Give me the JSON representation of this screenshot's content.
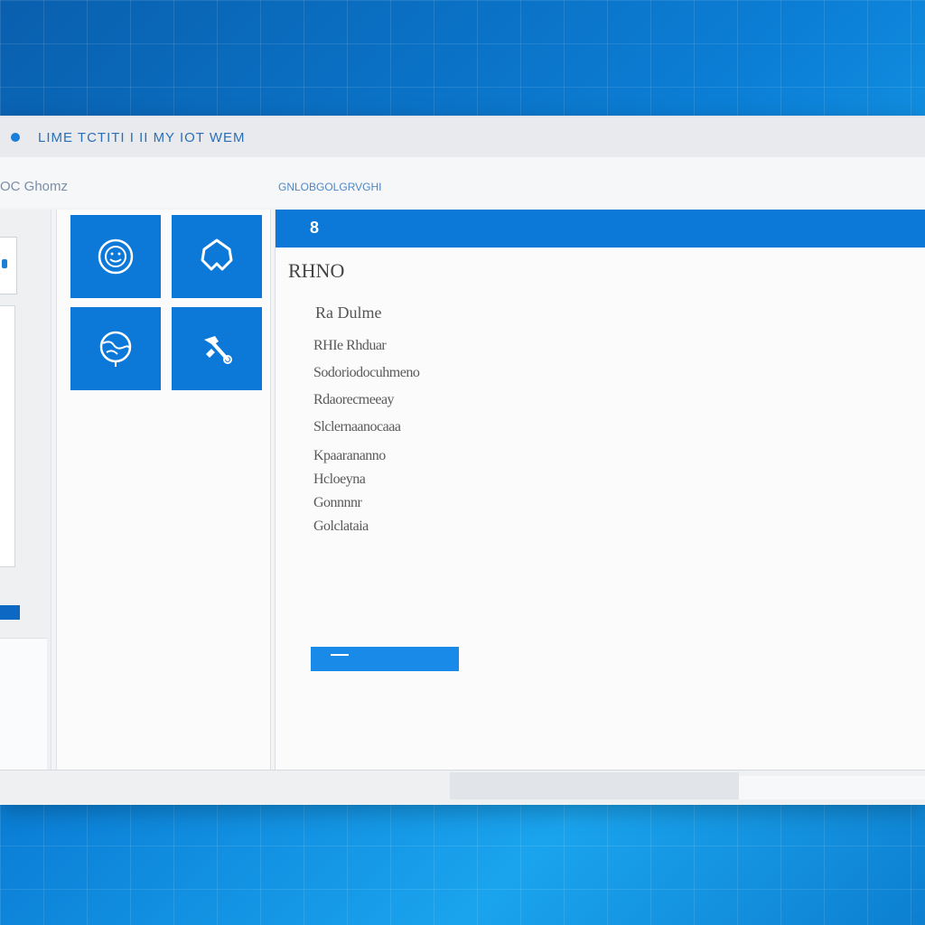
{
  "window": {
    "title": "LIME TCTITI I II MY IOT WEM"
  },
  "toolbar": {
    "left_label": "OC Ghomz",
    "right_label": "GNLOBGOLGRVGHI"
  },
  "tiles": [
    {
      "icon": "smiley-icon"
    },
    {
      "icon": "shield-icon"
    },
    {
      "icon": "globe-icon"
    },
    {
      "icon": "tools-icon"
    }
  ],
  "main": {
    "header_label": "8",
    "title": "RHNO",
    "section_title": "Ra Dulme",
    "items": [
      "RHIe Rhduar",
      "Sodoriodocuhmeno",
      "Rdaorecmeeay",
      "Slclernaanocaaa",
      "Kpaarananno",
      "Hcloeyna",
      "Gonnnnr",
      "Golclataia"
    ],
    "button_label": ""
  },
  "colors": {
    "accent": "#0c78d8",
    "button": "#1a8ae8",
    "desktop": "#0b7fd6"
  }
}
